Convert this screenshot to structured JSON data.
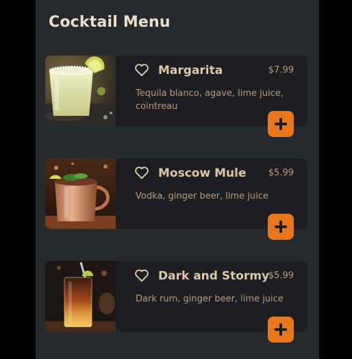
{
  "header": {
    "title": "Cocktail Menu"
  },
  "menu": {
    "items": [
      {
        "name": "Margarita",
        "price": "$7.99",
        "description": "Tequila blanco, agave, lime juice, cointreau"
      },
      {
        "name": "Moscow Mule",
        "price": "$5.99",
        "description": "Vodka, ginger beer, lime juice"
      },
      {
        "name": "Dark and Stormy",
        "price": "$5.99",
        "description": "Dark rum, ginger beer, lime juice"
      }
    ]
  },
  "colors": {
    "panel_background": "#26292d",
    "card_background": "#1c1e21",
    "title_text": "#ece0cc",
    "item_name_text": "#ddc7a7",
    "secondary_text": "#b89f7f",
    "accent": "#e8761d"
  },
  "icons": {
    "favorite": "heart-outline-icon",
    "add": "plus-icon"
  }
}
